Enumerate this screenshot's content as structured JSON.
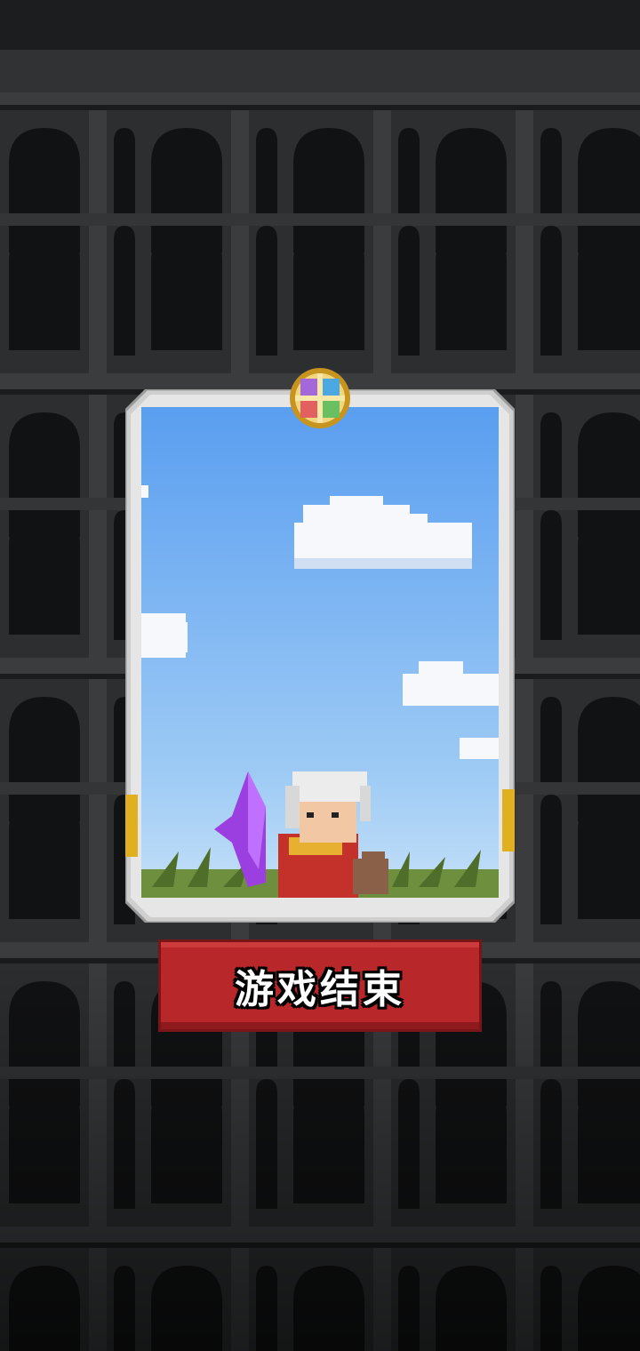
{
  "game": {
    "end_button_label": "游戏结束"
  },
  "card": {
    "scene": "sky-with-clouds",
    "character": "white-haired-elder-in-red-robe",
    "companion": "brown-pet-dog",
    "item": "purple-crystal",
    "emblem": "four-color-cross-emblem-icon"
  },
  "colors": {
    "background": "#242526",
    "wall": "#2e3031",
    "button": "#b8272a",
    "card_frame": "#d8d8d8",
    "sky_top": "#5a9ef0",
    "sky_bottom": "#c5e0f8"
  }
}
